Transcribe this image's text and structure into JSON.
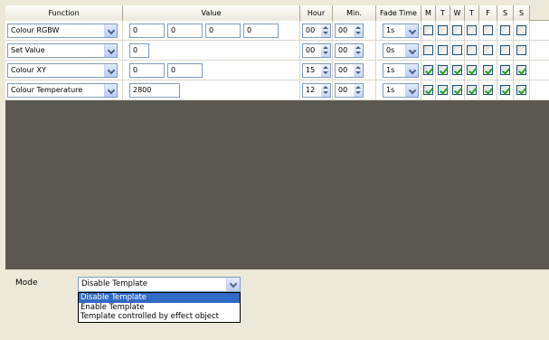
{
  "grid": {
    "headers": {
      "function": "Function",
      "value": "Value",
      "hour": "Hour",
      "min": "Min.",
      "fade_time": "Fade Time",
      "days": [
        "M",
        "T",
        "W",
        "T",
        "F",
        "S",
        "S"
      ]
    },
    "rows": [
      {
        "function": "Colour RGBW",
        "values": [
          "0",
          "0",
          "0",
          "0"
        ],
        "hour": "00",
        "min": "00",
        "fade": "1s",
        "days": [
          false,
          false,
          false,
          false,
          false,
          false,
          false
        ]
      },
      {
        "function": "Set Value",
        "values": [
          "0"
        ],
        "hour": "00",
        "min": "00",
        "fade": "0s",
        "days": [
          false,
          false,
          false,
          false,
          false,
          false,
          false
        ]
      },
      {
        "function": "Colour XY",
        "values": [
          "0",
          "0"
        ],
        "hour": "15",
        "min": "00",
        "fade": "1s",
        "days": [
          true,
          true,
          true,
          true,
          true,
          true,
          true
        ]
      },
      {
        "function": "Colour Temperature",
        "values": [
          "2800"
        ],
        "hour": "12",
        "min": "00",
        "fade": "1s",
        "days": [
          true,
          true,
          true,
          true,
          true,
          true,
          true
        ]
      }
    ]
  },
  "mode": {
    "label": "Mode",
    "selected": "Disable Template",
    "options": [
      "Disable Template",
      "Enable Template",
      "Template controlled by effect object"
    ]
  },
  "colors": {
    "grid_background": "#5b5852",
    "window_background": "#ece9d8",
    "selection": "#316ac5",
    "check": "#21a121"
  },
  "icons": {
    "dropdown": "chevron-down-icon",
    "spinner": "spinner-arrows-icon",
    "check": "checkmark-icon"
  }
}
